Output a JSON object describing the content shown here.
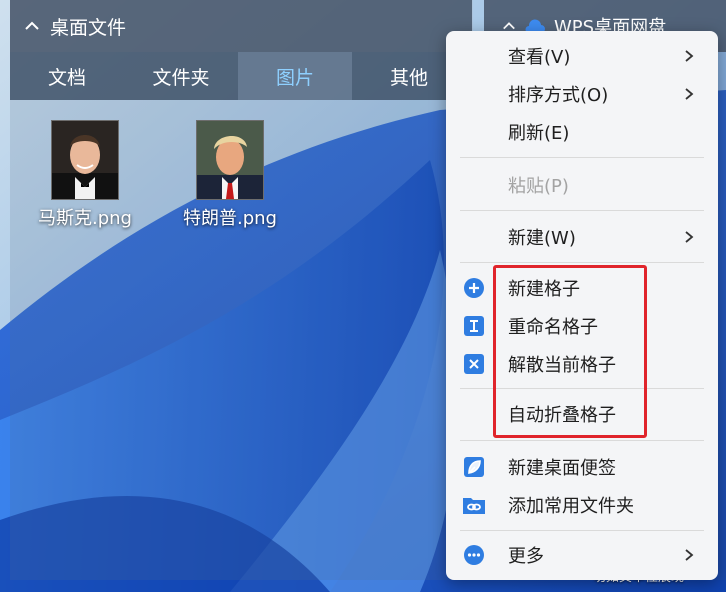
{
  "fence": {
    "title": "桌面文件",
    "tabs": [
      {
        "label": "文档",
        "active": false
      },
      {
        "label": "文件夹",
        "active": false
      },
      {
        "label": "图片",
        "active": true
      },
      {
        "label": "其他",
        "active": false
      }
    ],
    "files": [
      {
        "name": "马斯克.png"
      },
      {
        "name": "特朗普.png"
      }
    ]
  },
  "fence2": {
    "title": "WPS桌面网盘"
  },
  "bottom_text": "一切如其本性展现",
  "menu": {
    "items": [
      {
        "label": "查看(V)",
        "submenu": true
      },
      {
        "label": "排序方式(O)",
        "submenu": true
      },
      {
        "label": "刷新(E)"
      },
      {
        "label": "粘贴(P)",
        "disabled": true
      },
      {
        "label": "新建(W)",
        "submenu": true
      },
      {
        "label": "新建格子",
        "icon": "plus-circle-icon"
      },
      {
        "label": "重命名格子",
        "icon": "rename-icon"
      },
      {
        "label": "解散当前格子",
        "icon": "dissolve-icon"
      },
      {
        "label": "自动折叠格子"
      },
      {
        "label": "新建桌面便签",
        "icon": "leaf-note-icon"
      },
      {
        "label": "添加常用文件夹",
        "icon": "link-folder-icon"
      },
      {
        "label": "更多",
        "icon": "more-icon",
        "submenu": true
      }
    ]
  },
  "colors": {
    "accent": "#2f7de1",
    "highlight_box": "#e0242b",
    "active_tab_text": "#8ed0ff"
  }
}
